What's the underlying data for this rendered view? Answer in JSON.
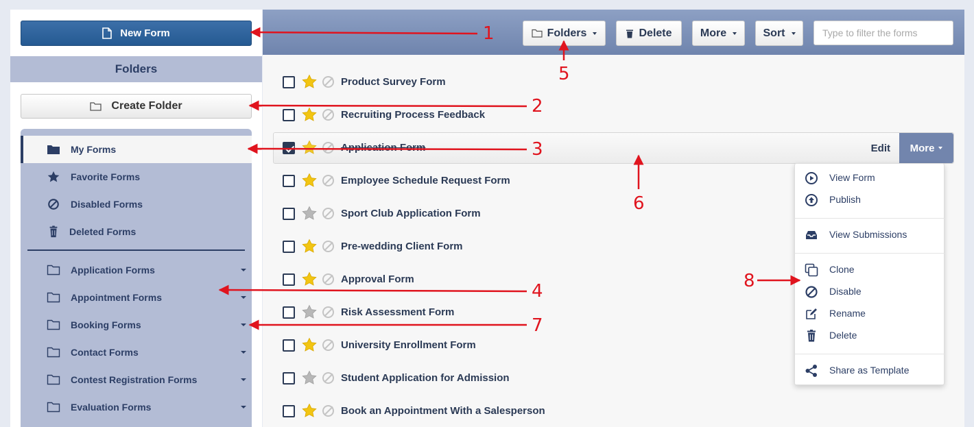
{
  "sidebar": {
    "new_form_label": "New Form",
    "folders_heading": "Folders",
    "create_folder_label": "Create Folder",
    "nav_items": [
      {
        "label": "My Forms",
        "icon": "folder-solid-icon"
      },
      {
        "label": "Favorite Forms",
        "icon": "star-icon"
      },
      {
        "label": "Disabled Forms",
        "icon": "disabled-icon"
      },
      {
        "label": "Deleted Forms",
        "icon": "trash-icon"
      }
    ],
    "folders": [
      {
        "label": "Application Forms"
      },
      {
        "label": "Appointment Forms"
      },
      {
        "label": "Booking Forms"
      },
      {
        "label": "Contact Forms"
      },
      {
        "label": "Contest Registration Forms"
      },
      {
        "label": "Evaluation Forms"
      }
    ]
  },
  "toolbar": {
    "folders_label": "Folders",
    "delete_label": "Delete",
    "more_label": "More",
    "sort_label": "Sort",
    "filter_placeholder": "Type to filter the forms"
  },
  "forms": [
    {
      "name": "Product Survey Form",
      "favorite": true,
      "selected": false
    },
    {
      "name": "Recruiting Process Feedback",
      "favorite": true,
      "selected": false
    },
    {
      "name": "Application Form",
      "favorite": true,
      "selected": true
    },
    {
      "name": "Employee Schedule Request Form",
      "favorite": true,
      "selected": false
    },
    {
      "name": "Sport Club Application Form",
      "favorite": false,
      "selected": false
    },
    {
      "name": "Pre-wedding Client Form",
      "favorite": true,
      "selected": false
    },
    {
      "name": "Approval Form",
      "favorite": true,
      "selected": false
    },
    {
      "name": "Risk Assessment Form",
      "favorite": false,
      "selected": false
    },
    {
      "name": "University Enrollment Form",
      "favorite": true,
      "selected": false
    },
    {
      "name": "Student Application for Admission",
      "favorite": false,
      "selected": false
    },
    {
      "name": "Book an Appointment With a Salesperson",
      "favorite": true,
      "selected": false
    }
  ],
  "row_actions": {
    "edit_label": "Edit",
    "more_label": "More"
  },
  "more_menu": [
    {
      "label": "View Form",
      "icon": "play-circle-icon"
    },
    {
      "label": "Publish",
      "icon": "upload-circle-icon"
    },
    {
      "label": "View Submissions",
      "icon": "inbox-icon"
    },
    {
      "label": "Clone",
      "icon": "clone-icon"
    },
    {
      "label": "Disable",
      "icon": "disabled-icon"
    },
    {
      "label": "Rename",
      "icon": "edit-icon"
    },
    {
      "label": "Delete",
      "icon": "trash-icon"
    },
    {
      "label": "Share as Template",
      "icon": "share-icon"
    }
  ],
  "annotations": [
    "1",
    "2",
    "3",
    "4",
    "5",
    "6",
    "7",
    "8"
  ],
  "colors": {
    "primary": "#2c5f97",
    "sidebar_panel": "#b3bcd5",
    "toolbar": "#7a8db5",
    "star_on": "#f2c513",
    "star_off": "#b5b5b5",
    "annotation": "#e0141e"
  }
}
